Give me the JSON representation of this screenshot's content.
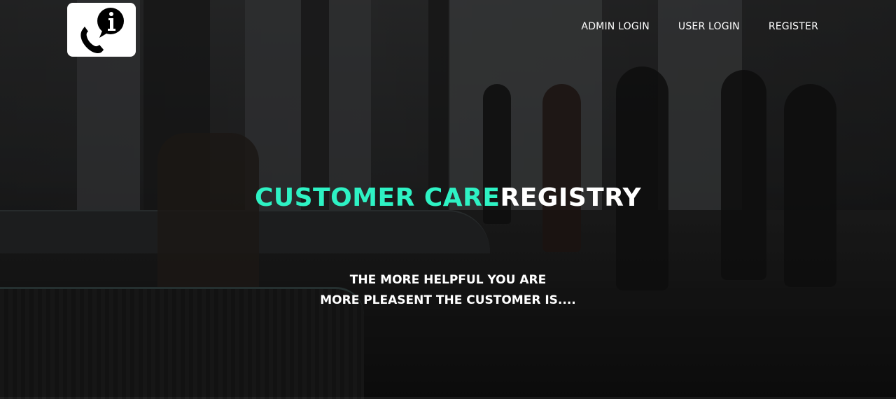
{
  "nav": {
    "items": [
      {
        "label": "ADMIN LOGIN"
      },
      {
        "label": "USER LOGIN"
      },
      {
        "label": "REGISTER"
      }
    ]
  },
  "logo": {
    "icon": "phone-info-icon"
  },
  "hero": {
    "title_accent": "CUSTOMER CARE",
    "title_plain": "REGISTRY",
    "tagline_line1": "THE MORE HELPFUL YOU ARE",
    "tagline_line2": "MORE PLEASENT THE CUSTOMER IS...."
  },
  "colors": {
    "accent": "#2ef2c4",
    "text": "#ffffff"
  }
}
